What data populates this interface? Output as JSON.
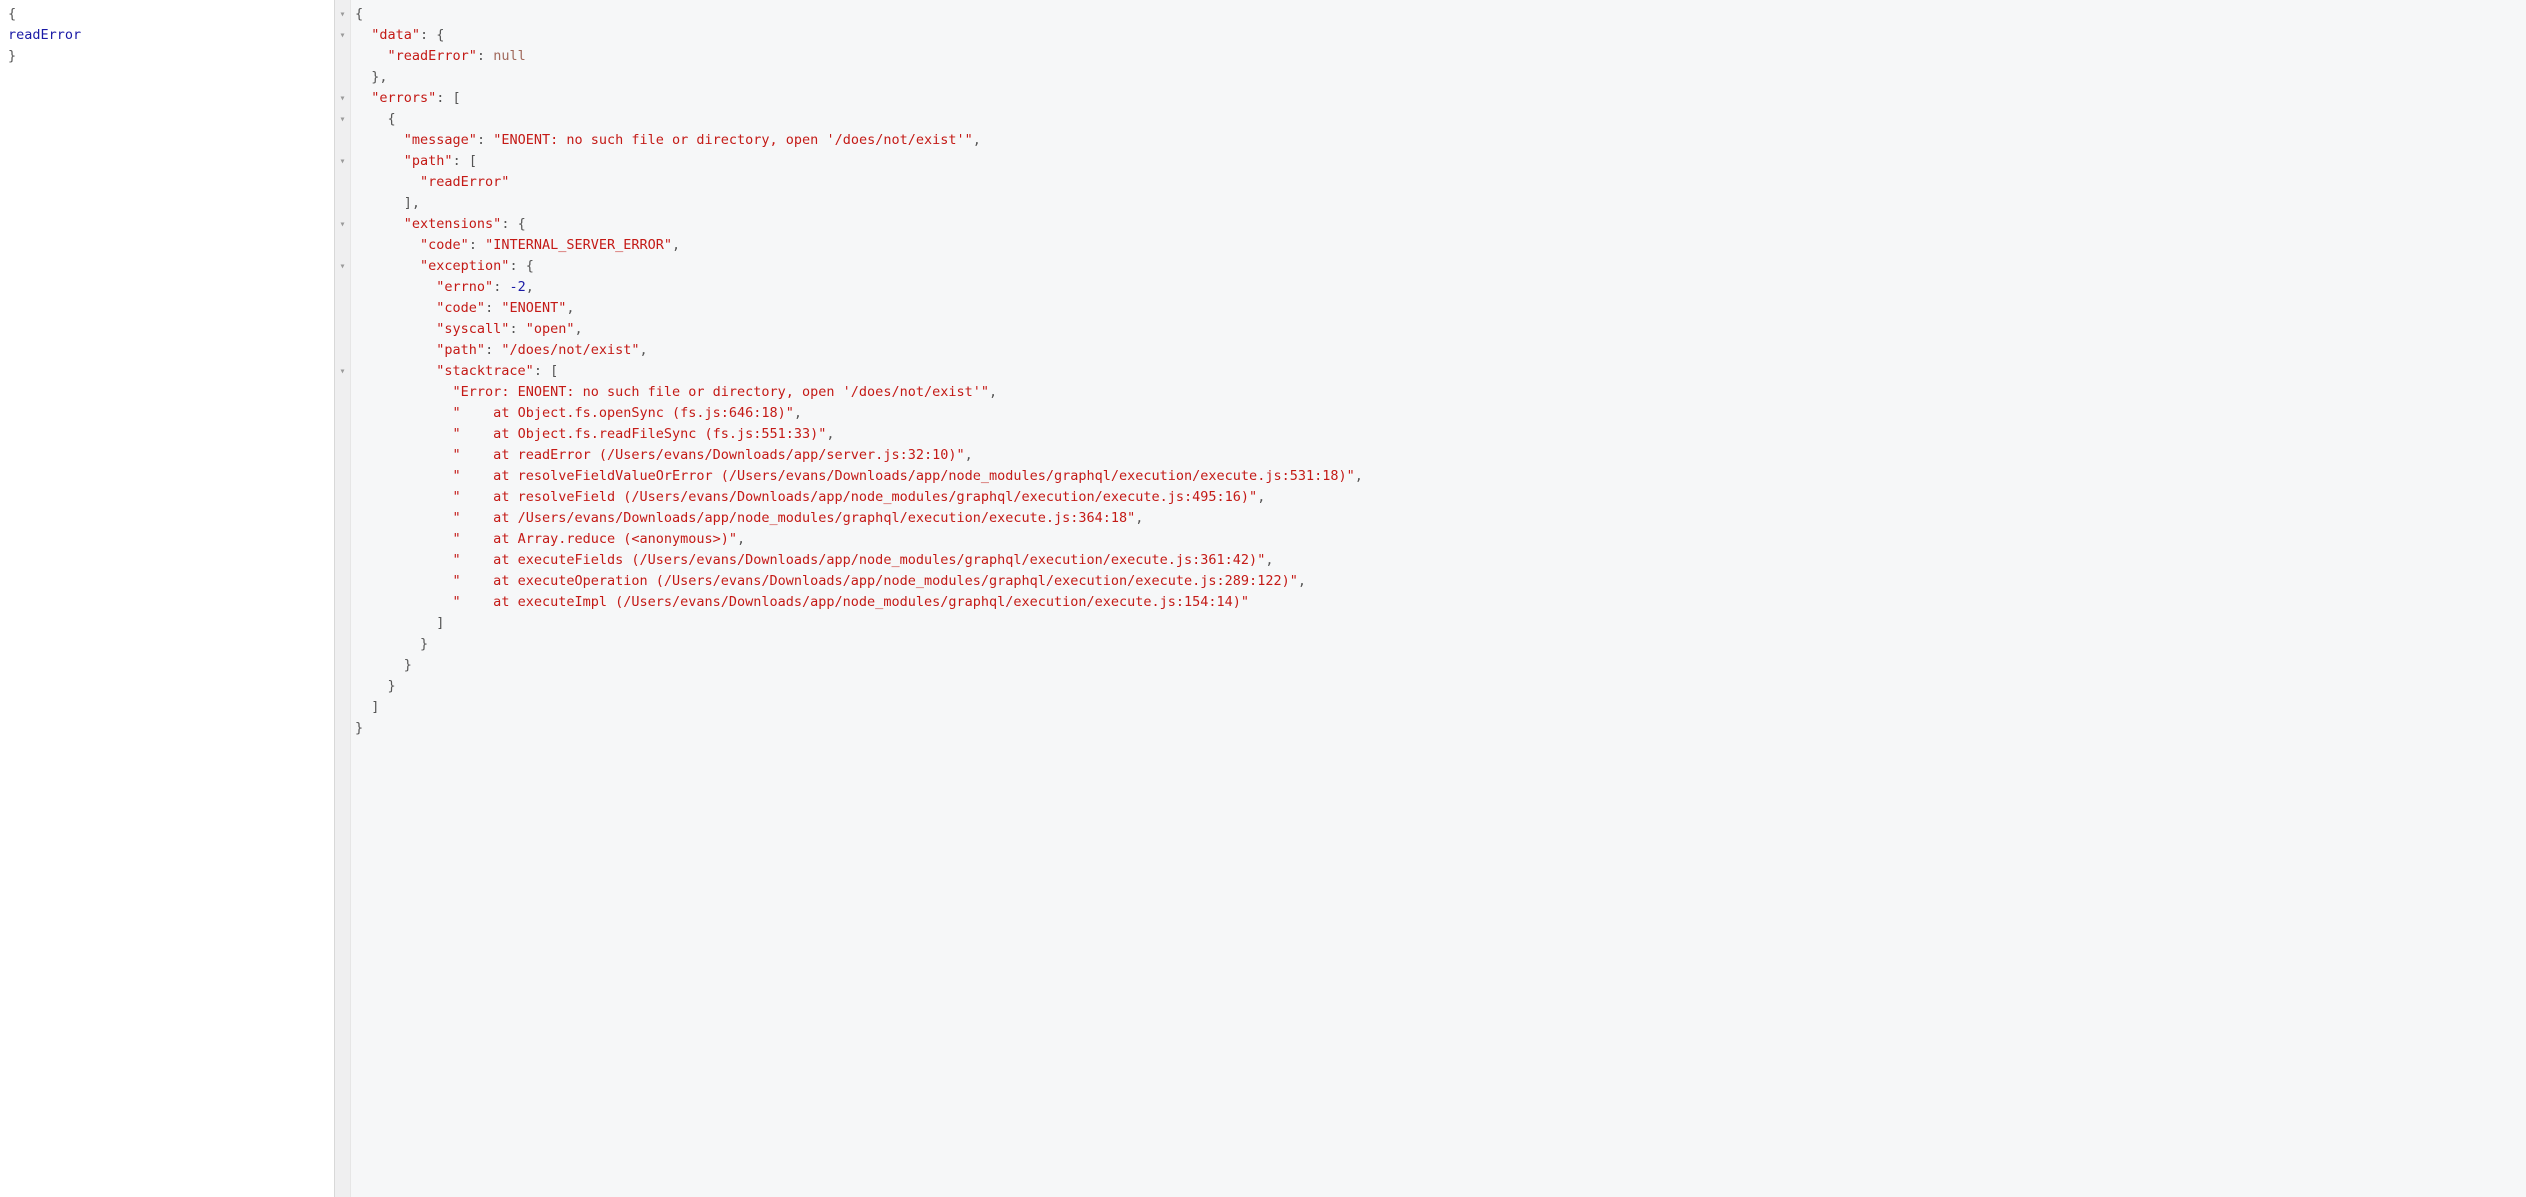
{
  "request": {
    "brace_open": "{",
    "field": "readError",
    "brace_close": "}"
  },
  "response": {
    "lines": [
      {
        "indent": 0,
        "tokens": [
          {
            "t": "punc",
            "v": "{"
          }
        ]
      },
      {
        "indent": 1,
        "tokens": [
          {
            "t": "key",
            "v": "\"data\""
          },
          {
            "t": "punc",
            "v": ": {"
          }
        ]
      },
      {
        "indent": 2,
        "tokens": [
          {
            "t": "key",
            "v": "\"readError\""
          },
          {
            "t": "punc",
            "v": ": "
          },
          {
            "t": "null",
            "v": "null"
          }
        ]
      },
      {
        "indent": 1,
        "tokens": [
          {
            "t": "punc",
            "v": "},"
          }
        ]
      },
      {
        "indent": 1,
        "tokens": [
          {
            "t": "key",
            "v": "\"errors\""
          },
          {
            "t": "punc",
            "v": ": ["
          }
        ]
      },
      {
        "indent": 2,
        "tokens": [
          {
            "t": "punc",
            "v": "{"
          }
        ]
      },
      {
        "indent": 3,
        "tokens": [
          {
            "t": "key",
            "v": "\"message\""
          },
          {
            "t": "punc",
            "v": ": "
          },
          {
            "t": "str",
            "v": "\"ENOENT: no such file or directory, open '/does/not/exist'\""
          },
          {
            "t": "punc",
            "v": ","
          }
        ]
      },
      {
        "indent": 3,
        "tokens": [
          {
            "t": "key",
            "v": "\"path\""
          },
          {
            "t": "punc",
            "v": ": ["
          }
        ]
      },
      {
        "indent": 4,
        "tokens": [
          {
            "t": "str",
            "v": "\"readError\""
          }
        ]
      },
      {
        "indent": 3,
        "tokens": [
          {
            "t": "punc",
            "v": "],"
          }
        ]
      },
      {
        "indent": 3,
        "tokens": [
          {
            "t": "key",
            "v": "\"extensions\""
          },
          {
            "t": "punc",
            "v": ": {"
          }
        ]
      },
      {
        "indent": 4,
        "tokens": [
          {
            "t": "key",
            "v": "\"code\""
          },
          {
            "t": "punc",
            "v": ": "
          },
          {
            "t": "str",
            "v": "\"INTERNAL_SERVER_ERROR\""
          },
          {
            "t": "punc",
            "v": ","
          }
        ]
      },
      {
        "indent": 4,
        "tokens": [
          {
            "t": "key",
            "v": "\"exception\""
          },
          {
            "t": "punc",
            "v": ": {"
          }
        ]
      },
      {
        "indent": 5,
        "tokens": [
          {
            "t": "key",
            "v": "\"errno\""
          },
          {
            "t": "punc",
            "v": ": "
          },
          {
            "t": "num",
            "v": "-2"
          },
          {
            "t": "punc",
            "v": ","
          }
        ]
      },
      {
        "indent": 5,
        "tokens": [
          {
            "t": "key",
            "v": "\"code\""
          },
          {
            "t": "punc",
            "v": ": "
          },
          {
            "t": "str",
            "v": "\"ENOENT\""
          },
          {
            "t": "punc",
            "v": ","
          }
        ]
      },
      {
        "indent": 5,
        "tokens": [
          {
            "t": "key",
            "v": "\"syscall\""
          },
          {
            "t": "punc",
            "v": ": "
          },
          {
            "t": "str",
            "v": "\"open\""
          },
          {
            "t": "punc",
            "v": ","
          }
        ]
      },
      {
        "indent": 5,
        "tokens": [
          {
            "t": "key",
            "v": "\"path\""
          },
          {
            "t": "punc",
            "v": ": "
          },
          {
            "t": "str",
            "v": "\"/does/not/exist\""
          },
          {
            "t": "punc",
            "v": ","
          }
        ]
      },
      {
        "indent": 5,
        "tokens": [
          {
            "t": "key",
            "v": "\"stacktrace\""
          },
          {
            "t": "punc",
            "v": ": ["
          }
        ]
      },
      {
        "indent": 6,
        "tokens": [
          {
            "t": "str",
            "v": "\"Error: ENOENT: no such file or directory, open '/does/not/exist'\""
          },
          {
            "t": "punc",
            "v": ","
          }
        ]
      },
      {
        "indent": 6,
        "tokens": [
          {
            "t": "str",
            "v": "\"    at Object.fs.openSync (fs.js:646:18)\""
          },
          {
            "t": "punc",
            "v": ","
          }
        ]
      },
      {
        "indent": 6,
        "tokens": [
          {
            "t": "str",
            "v": "\"    at Object.fs.readFileSync (fs.js:551:33)\""
          },
          {
            "t": "punc",
            "v": ","
          }
        ]
      },
      {
        "indent": 6,
        "tokens": [
          {
            "t": "str",
            "v": "\"    at readError (/Users/evans/Downloads/app/server.js:32:10)\""
          },
          {
            "t": "punc",
            "v": ","
          }
        ]
      },
      {
        "indent": 6,
        "tokens": [
          {
            "t": "str",
            "v": "\"    at resolveFieldValueOrError (/Users/evans/Downloads/app/node_modules/graphql/execution/execute.js:531:18)\""
          },
          {
            "t": "punc",
            "v": ","
          }
        ]
      },
      {
        "indent": 6,
        "tokens": [
          {
            "t": "str",
            "v": "\"    at resolveField (/Users/evans/Downloads/app/node_modules/graphql/execution/execute.js:495:16)\""
          },
          {
            "t": "punc",
            "v": ","
          }
        ]
      },
      {
        "indent": 6,
        "tokens": [
          {
            "t": "str",
            "v": "\"    at /Users/evans/Downloads/app/node_modules/graphql/execution/execute.js:364:18\""
          },
          {
            "t": "punc",
            "v": ","
          }
        ]
      },
      {
        "indent": 6,
        "tokens": [
          {
            "t": "str",
            "v": "\"    at Array.reduce (<anonymous>)\""
          },
          {
            "t": "punc",
            "v": ","
          }
        ]
      },
      {
        "indent": 6,
        "tokens": [
          {
            "t": "str",
            "v": "\"    at executeFields (/Users/evans/Downloads/app/node_modules/graphql/execution/execute.js:361:42)\""
          },
          {
            "t": "punc",
            "v": ","
          }
        ]
      },
      {
        "indent": 6,
        "tokens": [
          {
            "t": "str",
            "v": "\"    at executeOperation (/Users/evans/Downloads/app/node_modules/graphql/execution/execute.js:289:122)\""
          },
          {
            "t": "punc",
            "v": ","
          }
        ]
      },
      {
        "indent": 6,
        "tokens": [
          {
            "t": "str",
            "v": "\"    at executeImpl (/Users/evans/Downloads/app/node_modules/graphql/execution/execute.js:154:14)\""
          }
        ]
      },
      {
        "indent": 5,
        "tokens": [
          {
            "t": "punc",
            "v": "]"
          }
        ]
      },
      {
        "indent": 4,
        "tokens": [
          {
            "t": "punc",
            "v": "}"
          }
        ]
      },
      {
        "indent": 3,
        "tokens": [
          {
            "t": "punc",
            "v": "}"
          }
        ]
      },
      {
        "indent": 2,
        "tokens": [
          {
            "t": "punc",
            "v": "}"
          }
        ]
      },
      {
        "indent": 1,
        "tokens": [
          {
            "t": "punc",
            "v": "]"
          }
        ]
      },
      {
        "indent": 0,
        "tokens": [
          {
            "t": "punc",
            "v": "}"
          }
        ]
      }
    ],
    "fold_lines": [
      1,
      2,
      5,
      6,
      8,
      11,
      13,
      18
    ]
  }
}
